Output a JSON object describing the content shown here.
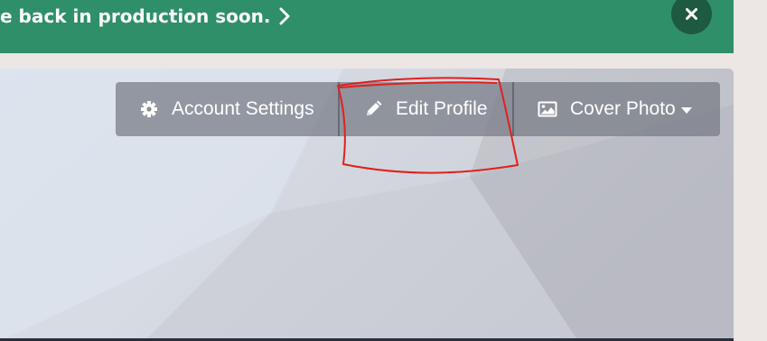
{
  "banner": {
    "text": "e back in production soon.",
    "chevron_icon": "chevron-right-icon",
    "close_icon": "close-icon",
    "background_color": "#2f8f69",
    "close_color": "#1e5a41"
  },
  "toolbar": {
    "account_settings": {
      "label": "Account Settings",
      "icon": "gear-icon"
    },
    "edit_profile": {
      "label": "Edit Profile",
      "icon": "pencil-icon"
    },
    "cover_photo": {
      "label": "Cover Photo",
      "icon": "image-icon",
      "dropdown_icon": "caret-down-icon"
    }
  },
  "annotation": {
    "color": "#e02020",
    "shape": "freehand-loop"
  }
}
